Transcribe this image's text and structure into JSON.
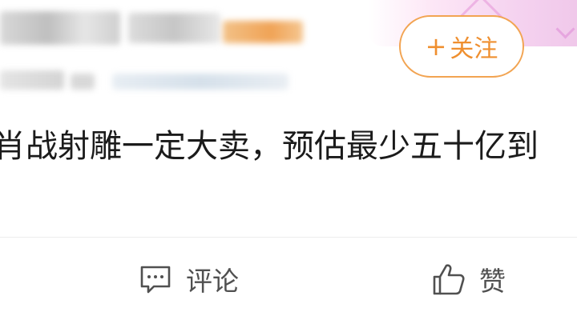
{
  "header": {
    "follow_button": {
      "plus": "+",
      "label": "关注"
    }
  },
  "post": {
    "text": "肖战射雕一定大卖，预估最少五十亿到"
  },
  "actions": {
    "comment_label": "评论",
    "like_label": "赞"
  },
  "colors": {
    "accent_orange": "#ef8f2f",
    "text_primary": "#1b1b1b",
    "text_secondary": "#505050",
    "supertopic_pink": "#e98ad9"
  },
  "icons": {
    "comment": "comment-icon",
    "like": "thumbs-up-icon"
  }
}
